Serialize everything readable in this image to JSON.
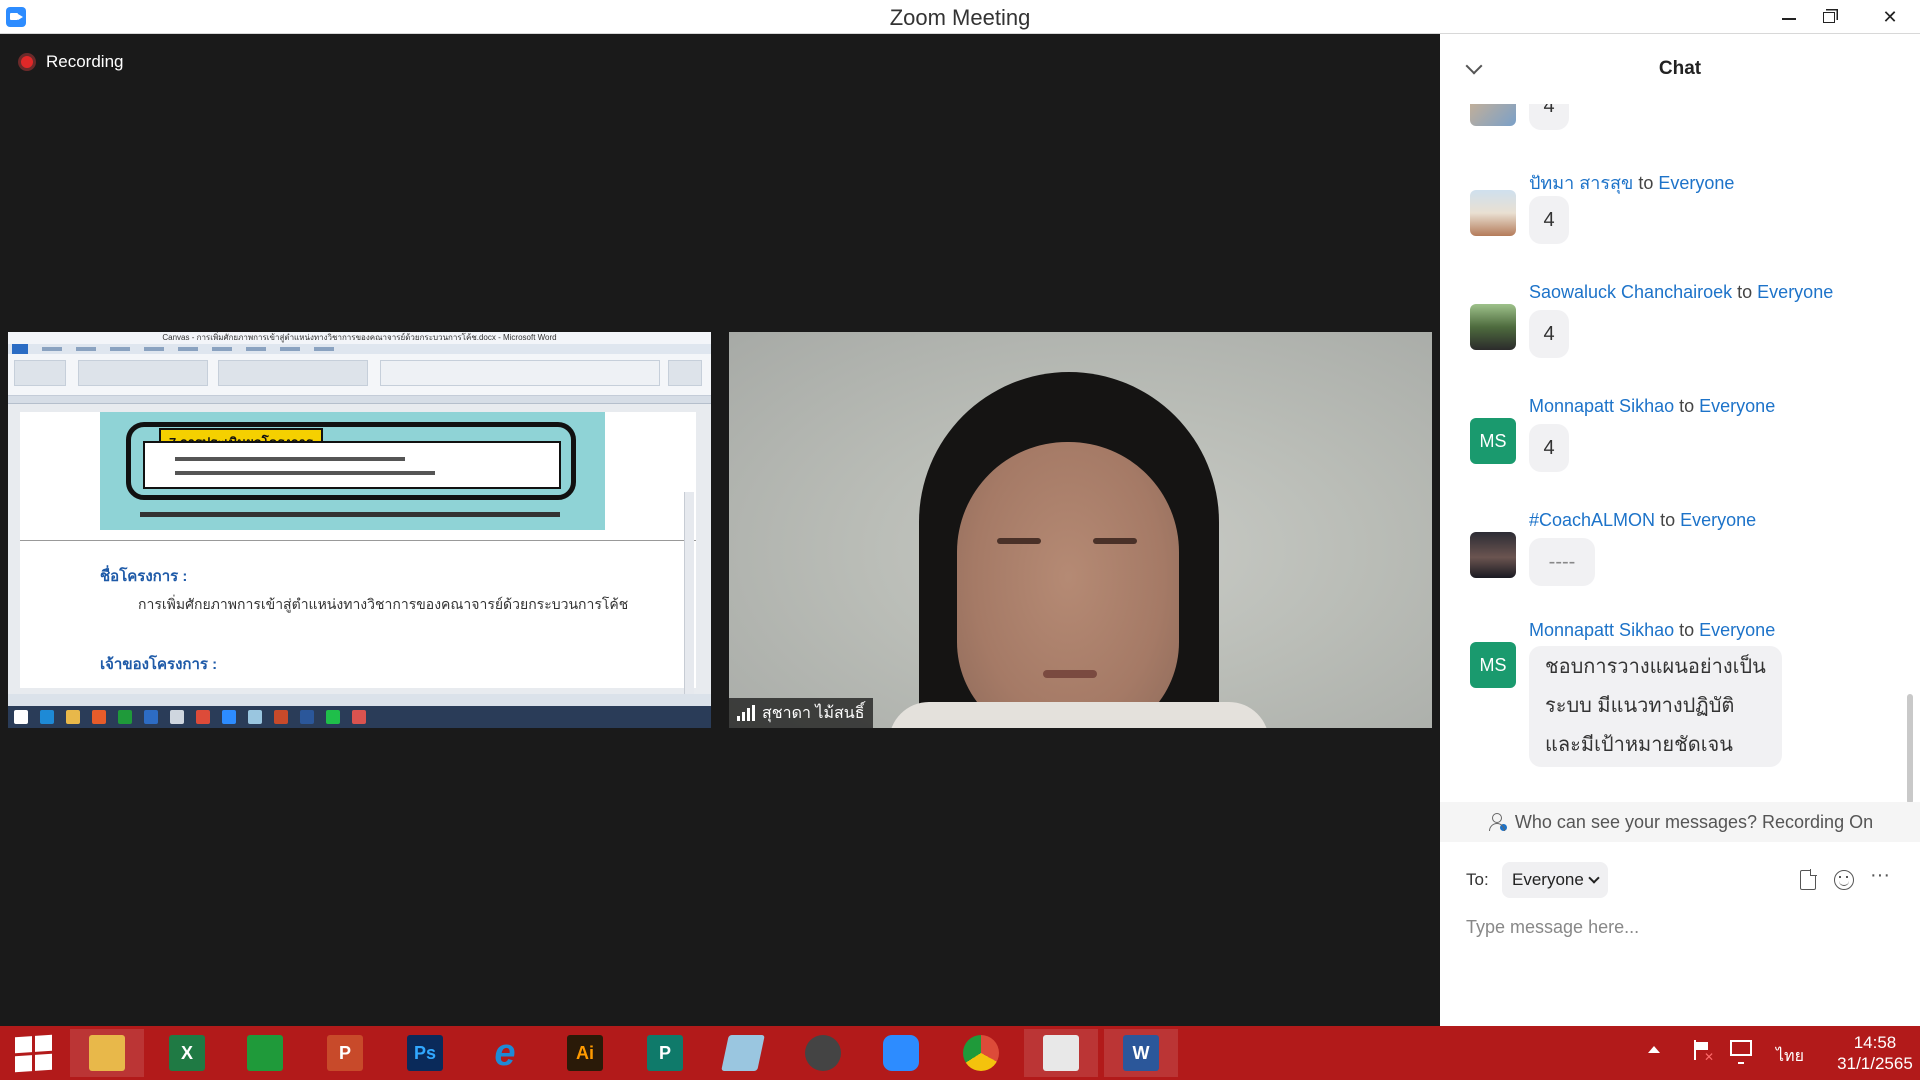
{
  "window": {
    "title": "Zoom Meeting"
  },
  "meeting": {
    "recording_label": "Recording",
    "participant_name": "สุชาดา ไม้สนธิ์"
  },
  "shared_document": {
    "window_title": "Canvas - การเพิ่มศักยภาพการเข้าสู่ตำแหน่งทางวิชาการของคณาจารย์ด้วยกระบวนการโค้ช.docx - Microsoft Word",
    "heading": "7.การประเมินผลโครงการ",
    "project_name_label": "ชื่อโครงการ :",
    "project_name": "การเพิ่มศักยภาพการเข้าสู่ตำแหน่งทางวิชาการของคณาจารย์ด้วยกระบวนการโค้ช",
    "project_owner_label": "เจ้าของโครงการ :"
  },
  "chat": {
    "title": "Chat",
    "to_word": "to",
    "messages": [
      {
        "sender": "",
        "target": "",
        "text": "4",
        "avatar": "photo1",
        "initials": ""
      },
      {
        "sender": "ปัทมา สารสุข",
        "target": "Everyone",
        "text": "4",
        "avatar": "photo2",
        "initials": ""
      },
      {
        "sender": "Saowaluck Chanchairoek",
        "target": "Everyone",
        "text": "4",
        "avatar": "photo3",
        "initials": ""
      },
      {
        "sender": "Monnapatt Sikhao",
        "target": "Everyone",
        "text": "4",
        "avatar": "ms",
        "initials": "MS"
      },
      {
        "sender": "#CoachALMON",
        "target": "Everyone",
        "text": "----",
        "avatar": "photo4",
        "initials": ""
      },
      {
        "sender": "Monnapatt Sikhao",
        "target": "Everyone",
        "text_lines": [
          "ชอบการวางแผนอย่างเป็น",
          "ระบบ มีแนวทางปฏิบัติ",
          "และมีเป้าหมายชัดเจน"
        ],
        "avatar": "ms",
        "initials": "MS"
      }
    ],
    "visibility_notice": "Who can see your messages? Recording On",
    "to_label": "To:",
    "recipient": "Everyone",
    "input_placeholder": "Type message here..."
  },
  "taskbar": {
    "apps": [
      {
        "name": "start",
        "label": ""
      },
      {
        "name": "file-explorer",
        "label": "",
        "color": "#e8b84a"
      },
      {
        "name": "excel",
        "label": "X",
        "color": "#1f7a44"
      },
      {
        "name": "store",
        "label": "",
        "color": "#1f9a3a"
      },
      {
        "name": "powerpoint",
        "label": "P",
        "color": "#c84a2a"
      },
      {
        "name": "photoshop",
        "label": "Ps",
        "color": "#0a2a5a"
      },
      {
        "name": "internet-explorer",
        "label": "e",
        "color": "#1e8ad6"
      },
      {
        "name": "illustrator",
        "label": "Ai",
        "color": "#2a1a08"
      },
      {
        "name": "publisher",
        "label": "P",
        "color": "#0f7a6a"
      },
      {
        "name": "notepad",
        "label": "",
        "color": "#9ac6e0"
      },
      {
        "name": "oCam",
        "label": "",
        "color": "#444444"
      },
      {
        "name": "zoom",
        "label": "",
        "color": "#2d8cff"
      },
      {
        "name": "chrome",
        "label": "",
        "color": "#dd4b39"
      },
      {
        "name": "presentation-app",
        "label": "",
        "color": "#e8e8e8"
      },
      {
        "name": "word",
        "label": "W",
        "color": "#2b579a"
      }
    ],
    "language": "ไทย",
    "time": "14:58",
    "date": "31/1/2565"
  },
  "colors": {
    "accent": "#2d8cff",
    "link": "#1d73c9",
    "taskbar": "#b21a1a",
    "avatar_ms": "#1a9a6e"
  }
}
